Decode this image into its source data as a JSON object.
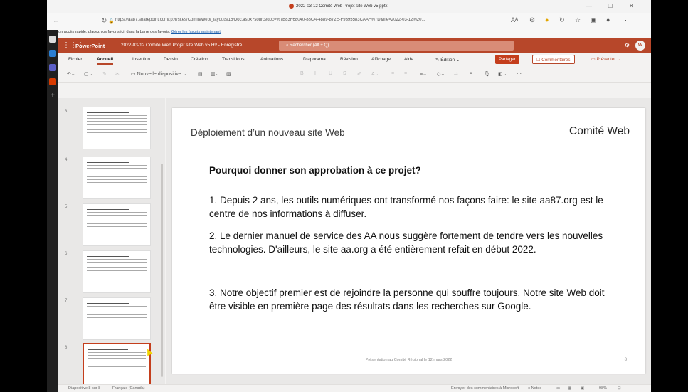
{
  "browser": {
    "tab_title": "2022-03-12 Comité Web Projet site Web v5.pptx",
    "url": "https://aa87.sharepoint.com/:p:/r/sites/ComiteWeb/_layouts/15/Doc.aspx?sourcedoc=%7B83F68040-88CA-4889-872E-F9395583CAAF%7D&file=2022-03-12%20...",
    "favbar_text": "Pour un accès rapide, placez vos favoris ici, dans la barre des favoris.",
    "favbar_link": "Gérer les favoris maintenant"
  },
  "app": {
    "name": "PowerPoint",
    "file_name": "2022-03-12 Comité Web Projet site Web v5  Hᴼ - Enregistré",
    "search_placeholder": "Rechercher (Alt + Q)",
    "avatar_initial": "W"
  },
  "ribbon": {
    "tabs": [
      "Fichier",
      "Accueil",
      "Insertion",
      "Dessin",
      "Création",
      "Transitions",
      "Animations",
      "Diaporama",
      "Révision",
      "Affichage",
      "Aide"
    ],
    "edition_label": "Édition",
    "share_label": "Partager",
    "comments_label": "Commentaires",
    "present_label": "Présenter",
    "new_slide_label": "Nouvelle diapositive"
  },
  "thumbnails": [
    "3",
    "4",
    "5",
    "6",
    "7",
    "8"
  ],
  "slide": {
    "header_left": "Déploiement d’un nouveau site Web",
    "header_right": "Comité Web",
    "question": "Pourquoi donner son approbation à ce projet?",
    "p1": "1. Depuis 2 ans, les outils numériques ont transformé nos façons faire: le site aa87.org est le centre de nos informations à diffuser.",
    "p2": "2. Le dernier manuel de service des AA nous suggère fortement de tendre vers les nouvelles technologies. D'ailleurs, le site aa.org a été entièrement refait en début 2022.",
    "p3": "3. Notre objectif premier est de rejoindre la personne qui souffre toujours. Notre site Web doit être visible en première page des résultats dans les recherches sur Google.",
    "footer": "Présentation au Comité Régional le 12 mars 2022",
    "page_number": "8"
  },
  "status": {
    "slide_info": "Diapositive 8 sur 8",
    "language": "Français (Canada)",
    "feedback": "Envoyer des commentaires à Microsoft",
    "notes": "Notes",
    "zoom": "98%"
  }
}
